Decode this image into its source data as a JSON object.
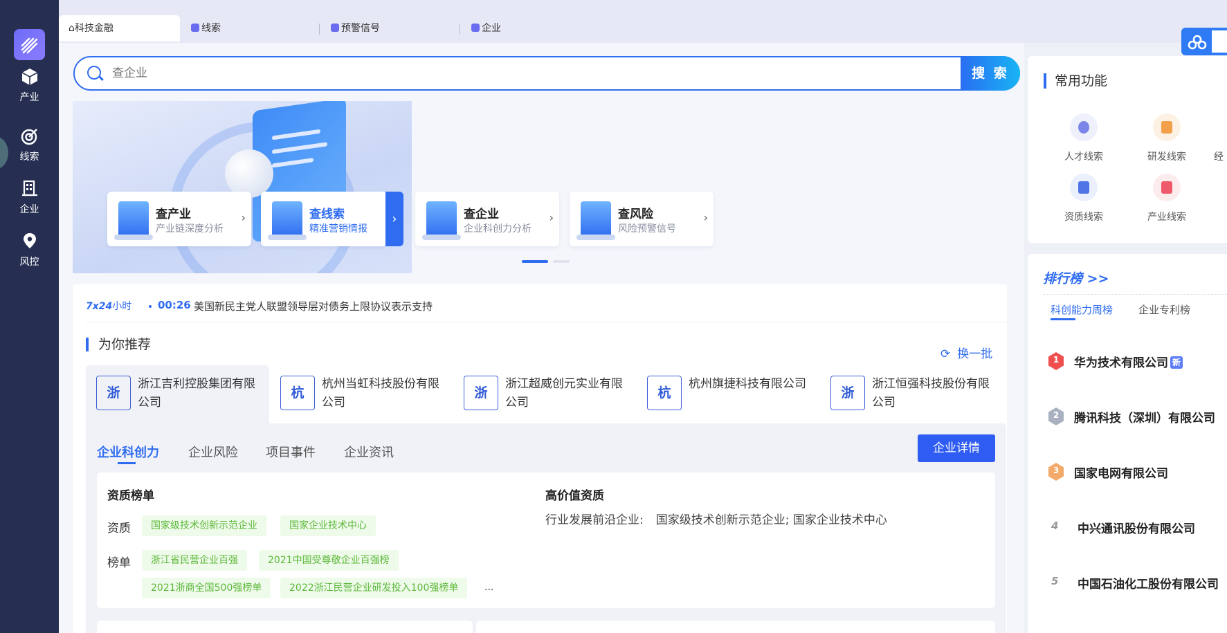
{
  "nav": {
    "items": [
      {
        "label": "产业",
        "icon": "cube-icon"
      },
      {
        "label": "线索",
        "icon": "target-icon"
      },
      {
        "label": "企业",
        "icon": "building-icon"
      },
      {
        "label": "风控",
        "icon": "location-pin-icon"
      }
    ]
  },
  "tabs": [
    {
      "label": "科技金融",
      "icon": "home-icon"
    },
    {
      "label": "线索",
      "icon": "hexagon-icon"
    },
    {
      "label": "预警信号",
      "icon": "hexagon-icon"
    },
    {
      "label": "企业",
      "icon": "hexagon-icon"
    }
  ],
  "search": {
    "placeholder": "查企业",
    "button": "搜 索"
  },
  "banner_cards": [
    {
      "title": "查产业",
      "subtitle": "产业链深度分析"
    },
    {
      "title": "查线索",
      "subtitle": "精准营销情报"
    },
    {
      "title": "查企业",
      "subtitle": "企业科创力分析"
    },
    {
      "title": "查风险",
      "subtitle": "风险预警信号"
    }
  ],
  "carousel": {
    "active_index": 0,
    "count": 2
  },
  "news": {
    "prefix_bold": "7x24",
    "prefix_rest": "小时",
    "time": "00:26",
    "text": "美国新民主党人联盟领导层对债务上限协议表示支持"
  },
  "recommend": {
    "title": "为你推荐",
    "refresh": "换一批",
    "companies": [
      {
        "badge": "浙",
        "name": "浙江吉利控股集团有限公司"
      },
      {
        "badge": "杭",
        "name": "杭州当虹科技股份有限公司"
      },
      {
        "badge": "浙",
        "name": "浙江超威创元实业有限公司"
      },
      {
        "badge": "杭",
        "name": "杭州旗捷科技有限公司"
      },
      {
        "badge": "浙",
        "name": "浙江恒强科技股份有限公司"
      }
    ]
  },
  "detail": {
    "tabs": [
      "企业科创力",
      "企业风险",
      "项目事件",
      "企业资讯"
    ],
    "button": "企业详情",
    "left_title": "资质榜单",
    "qual_label": "资质",
    "qual_tags": [
      "国家级技术创新示范企业",
      "国家企业技术中心"
    ],
    "rank_label": "榜单",
    "rank_tags_row1": [
      "浙江省民营企业百强",
      "2021中国受尊敬企业百强榜"
    ],
    "rank_tags_row2": [
      "2021浙商全国500强榜单",
      "2022浙江民营企业研发投入100强榜单"
    ],
    "ellipsis": "...",
    "right_title": "高价值资质",
    "right_label": "行业发展前沿企业:",
    "right_value": "国家级技术创新示范企业; 国家企业技术中心"
  },
  "common": {
    "title": "常用功能",
    "items": [
      {
        "label": "人才线索",
        "icon": "people-icon"
      },
      {
        "label": "研发线索",
        "icon": "code-icon"
      },
      {
        "label": "经",
        "icon": "partial-icon"
      },
      {
        "label": "资质线索",
        "icon": "document-icon"
      },
      {
        "label": "产业线索",
        "icon": "folder-icon"
      }
    ]
  },
  "ranking": {
    "title": "排行榜 >>",
    "tabs": [
      "科创能力周榜",
      "企业专利榜"
    ],
    "items": [
      {
        "rank": "1",
        "name": "华为技术有限公司",
        "badge": "新"
      },
      {
        "rank": "2",
        "name": "腾讯科技（深圳）有限公司"
      },
      {
        "rank": "3",
        "name": "国家电网有限公司"
      },
      {
        "rank": "4",
        "name": "中兴通讯股份有限公司"
      },
      {
        "rank": "5",
        "name": "中国石油化工股份有限公司"
      }
    ]
  },
  "colors": {
    "accent": "#2f6cf0",
    "nav_bg": "#262f52",
    "tag_green": "#5cb83b"
  }
}
